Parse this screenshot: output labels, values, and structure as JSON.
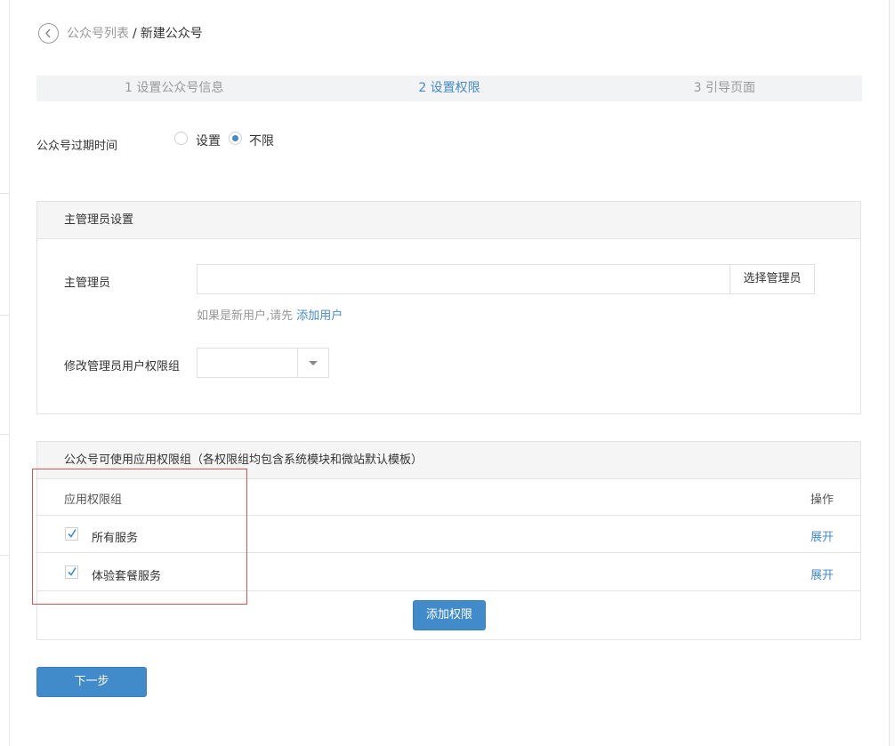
{
  "header": {
    "back_icon": "chevron-left-icon",
    "breadcrumb_parent": "公众号列表",
    "breadcrumb_separator": "/",
    "breadcrumb_current": "新建公众号"
  },
  "steps": [
    {
      "label": "1 设置公众号信息",
      "active": false
    },
    {
      "label": "2 设置权限",
      "active": true
    },
    {
      "label": "3 引导页面",
      "active": false
    }
  ],
  "expiry": {
    "label": "公众号过期时间",
    "options": [
      {
        "label": "设置",
        "checked": false
      },
      {
        "label": "不限",
        "checked": true
      }
    ]
  },
  "admin_panel": {
    "title": "主管理员设置",
    "admin_label": "主管理员",
    "admin_value": "",
    "select_admin_button": "选择管理员",
    "hint_prefix": "如果是新用户,请先",
    "hint_link": "添加用户",
    "group_label": "修改管理员用户权限组",
    "group_value": ""
  },
  "perm_panel": {
    "title": "公众号可使用应用权限组（各权限组均包含系统模块和微站默认模板）",
    "col_group": "应用权限组",
    "col_action": "操作",
    "rows": [
      {
        "name": "所有服务",
        "checked": true,
        "action": "展开"
      },
      {
        "name": "体验套餐服务",
        "checked": true,
        "action": "展开"
      }
    ],
    "add_button": "添加权限"
  },
  "footer": {
    "next_button": "下一步"
  },
  "colors": {
    "accent": "#428bca",
    "highlight": "#d9534f"
  }
}
